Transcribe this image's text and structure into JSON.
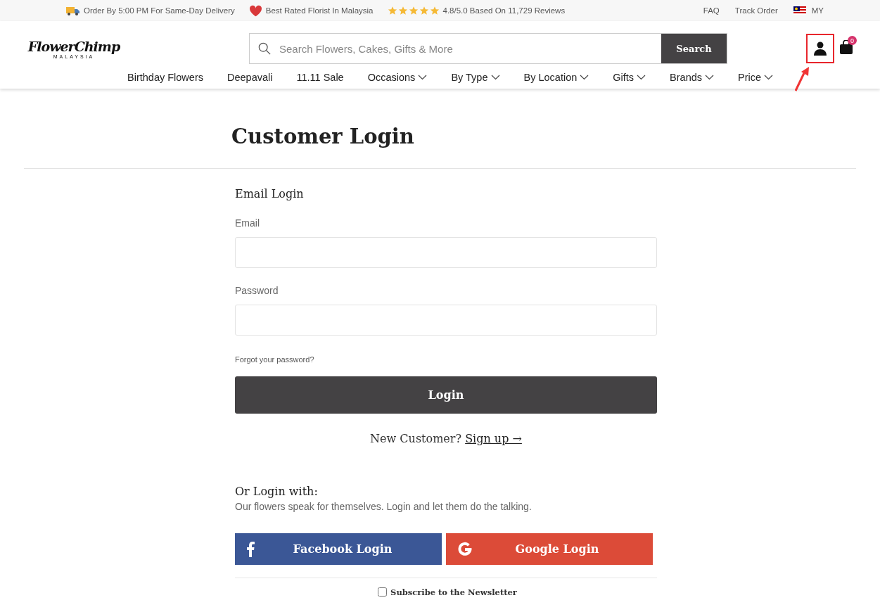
{
  "top_bar": {
    "promos": [
      {
        "kind": "truck",
        "text": "Order By 5:00 PM For Same-Day Delivery"
      },
      {
        "kind": "heart",
        "text": "Best Rated Florist In Malaysia"
      }
    ],
    "rating": {
      "stars": 5,
      "text": "4.8/5.0 Based On 11,729 Reviews"
    },
    "links": [
      "FAQ",
      "Track Order"
    ],
    "country": "MY"
  },
  "header": {
    "logo": {
      "name": "FlowerChimp",
      "sub": "MALAYSIA"
    },
    "search": {
      "placeholder": "Search Flowers, Cakes, Gifts & More",
      "button": "Search"
    },
    "cart_count": "0",
    "account_highlighted": true
  },
  "nav": [
    {
      "label": "Birthday Flowers",
      "dropdown": false
    },
    {
      "label": "Deepavali",
      "dropdown": false
    },
    {
      "label": "11.11 Sale",
      "dropdown": false
    },
    {
      "label": "Occasions",
      "dropdown": true
    },
    {
      "label": "By Type",
      "dropdown": true
    },
    {
      "label": "By Location",
      "dropdown": true
    },
    {
      "label": "Gifts",
      "dropdown": true
    },
    {
      "label": "Brands",
      "dropdown": true
    },
    {
      "label": "Price",
      "dropdown": true
    }
  ],
  "page": {
    "title": "Customer Login",
    "section": "Email Login",
    "fields": [
      {
        "label": "Email"
      },
      {
        "label": "Password"
      }
    ],
    "forgot": "Forgot your password?",
    "login_button": "Login",
    "new_customer": "New Customer?",
    "signup": "Sign up →",
    "social_title": "Or Login with:",
    "social_text": "Our flowers speak for themselves. Login and let them do the talking.",
    "social": [
      {
        "kind": "facebook",
        "label": "Facebook Login",
        "color": "#3b5796"
      },
      {
        "kind": "google",
        "label": "Google Login",
        "color": "#dc4b38"
      }
    ],
    "newsletter": {
      "label": "Subscribe to the Newsletter",
      "checked": false
    }
  }
}
